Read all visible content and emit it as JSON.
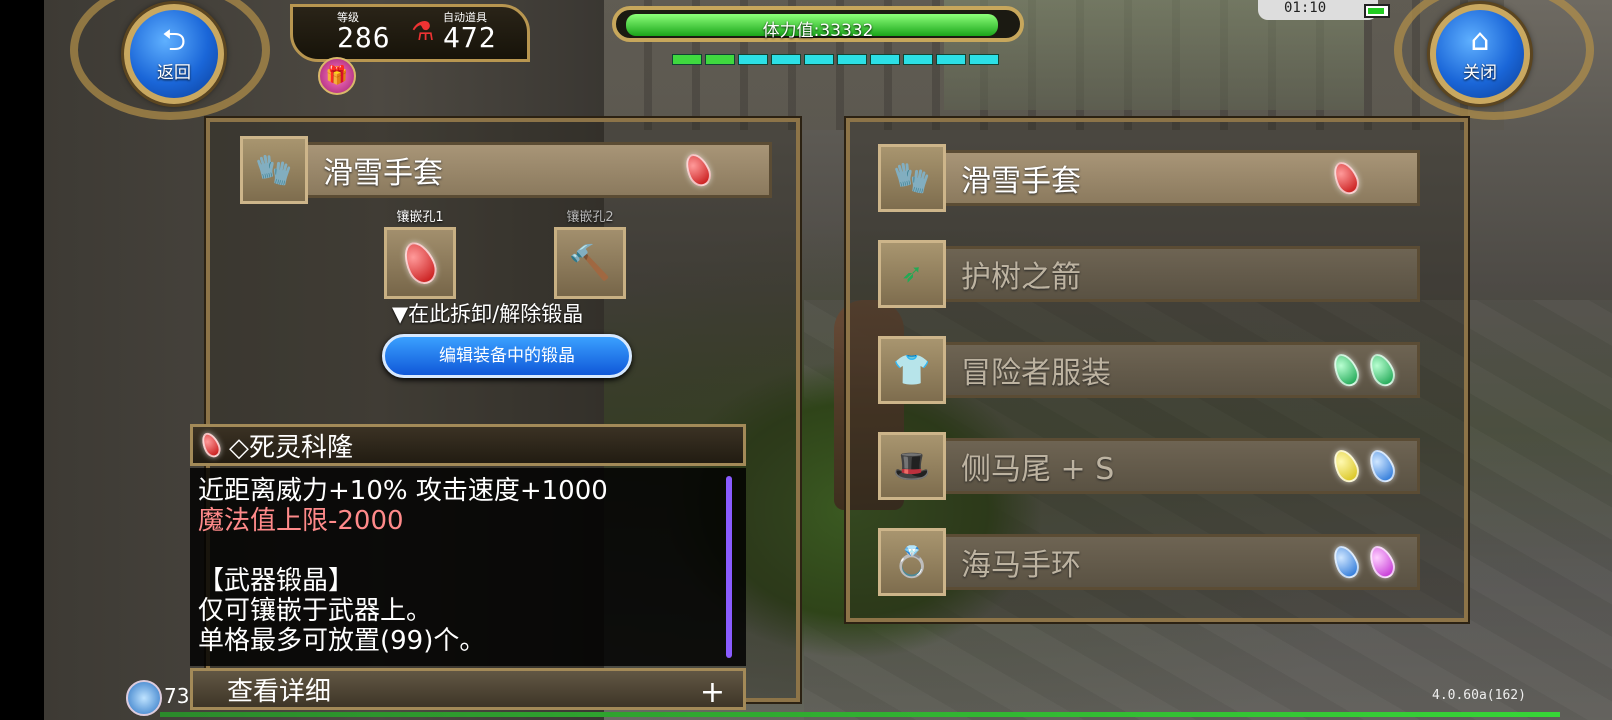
{
  "hud": {
    "back_label": "返回",
    "close_label": "关闭",
    "level_caption": "等级",
    "level_value": "286",
    "auto_item_caption": "自动道具",
    "auto_item_value": "472",
    "hp_text": "体力值:33332",
    "hp_fraction": 0.97,
    "mp_segments": [
      "green",
      "green",
      "cyan",
      "cyan",
      "cyan",
      "cyan",
      "cyan",
      "cyan",
      "cyan",
      "cyan"
    ],
    "clock": "01:10"
  },
  "left_panel": {
    "item_name": "滑雪手套",
    "item_gem": "red",
    "holes": [
      {
        "caption": "镶嵌孔1",
        "content": "red-gem"
      },
      {
        "caption": "镶嵌孔2",
        "content": "hammer"
      }
    ],
    "hint": "▼在此拆卸/解除锻晶",
    "edit_button": "编辑装备中的锻晶"
  },
  "description": {
    "title": "◇死灵科隆",
    "lines": [
      {
        "text": "近距离威力+10% 攻击速度+1000",
        "type": "normal"
      },
      {
        "text": "魔法值上限-2000",
        "type": "negative"
      },
      {
        "text": "",
        "type": "normal"
      },
      {
        "text": "【武器锻晶】",
        "type": "normal"
      },
      {
        "text": "仅可镶嵌于武器上。",
        "type": "normal"
      },
      {
        "text": "单格最多可放置(99)个。",
        "type": "normal"
      }
    ],
    "detail_label": "查看详细",
    "plus": "+"
  },
  "right_panel": {
    "items": [
      {
        "name": "滑雪手套",
        "icon": "glove-icon",
        "gems": [
          "red"
        ],
        "dim": false
      },
      {
        "name": "护树之箭",
        "icon": "arrow-icon",
        "gems": [],
        "dim": true
      },
      {
        "name": "冒险者服装",
        "icon": "armor-icon",
        "gems": [
          "green",
          "green"
        ],
        "dim": true
      },
      {
        "name": "侧马尾 + S",
        "icon": "hat-icon",
        "gems": [
          "yellow",
          "blue"
        ],
        "dim": true
      },
      {
        "name": "海马手环",
        "icon": "ring-icon",
        "gems": [
          "blue",
          "pink"
        ],
        "dim": true
      }
    ]
  },
  "footer": {
    "bottom_number": "73",
    "version": "4.0.60a(162)"
  }
}
